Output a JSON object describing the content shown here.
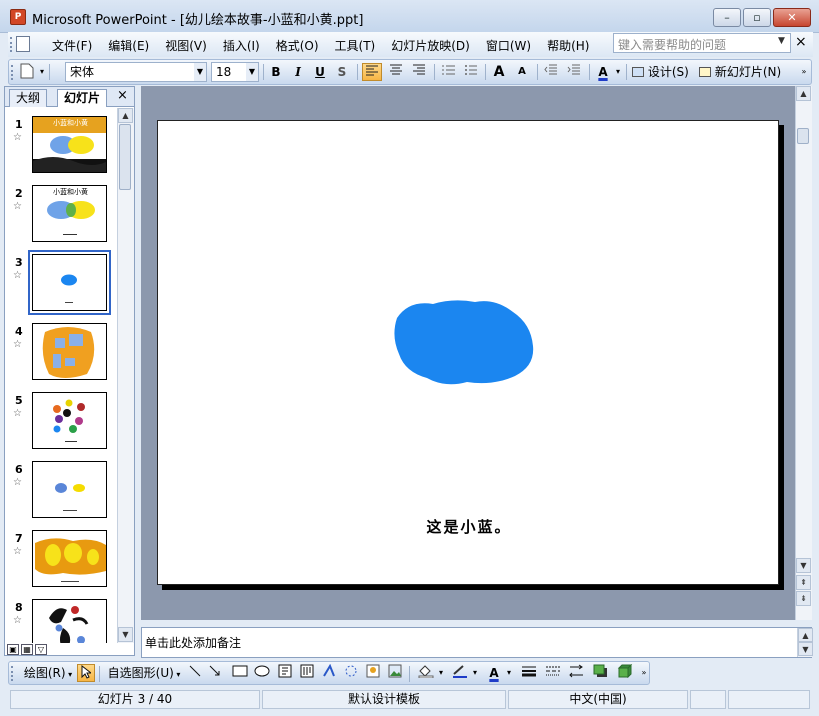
{
  "window": {
    "app_icon": "powerpoint-icon",
    "title": "Microsoft PowerPoint - [幼儿绘本故事-小蓝和小黄.ppt]",
    "buttons": {
      "minimize": "–",
      "restore": "▫",
      "close": "✕"
    }
  },
  "menubar": {
    "items": [
      {
        "label": "文件(F)"
      },
      {
        "label": "编辑(E)"
      },
      {
        "label": "视图(V)"
      },
      {
        "label": "插入(I)"
      },
      {
        "label": "格式(O)"
      },
      {
        "label": "工具(T)"
      },
      {
        "label": "幻灯片放映(D)"
      },
      {
        "label": "窗口(W)"
      },
      {
        "label": "帮助(H)"
      }
    ],
    "help_placeholder": "键入需要帮助的问题",
    "help_close": "×"
  },
  "toolbar": {
    "font_name": "宋体",
    "font_size": "18",
    "bold": "B",
    "italic": "I",
    "underline": "U",
    "shadow": "S",
    "grow_font": "A",
    "shrink_font": "A",
    "font_color": "A",
    "design_label": "设计(S)",
    "new_slide_label": "新幻灯片(N)"
  },
  "slide_pane": {
    "tabs": [
      {
        "label": "大纲"
      },
      {
        "label": "幻灯片"
      }
    ],
    "close": "×",
    "thumbnails": [
      {
        "number": "1",
        "star": "☆",
        "title_text": "小蓝和小黄"
      },
      {
        "number": "2",
        "star": "☆",
        "title_text": "小蓝和小黄"
      },
      {
        "number": "3",
        "star": "☆",
        "selected": true
      },
      {
        "number": "4",
        "star": "☆"
      },
      {
        "number": "5",
        "star": "☆"
      },
      {
        "number": "6",
        "star": "☆"
      },
      {
        "number": "7",
        "star": "☆"
      },
      {
        "number": "8",
        "star": "☆"
      }
    ]
  },
  "slide": {
    "caption": "这是小蓝。",
    "blob_color": "#1b86f0"
  },
  "notes": {
    "placeholder": "单击此处添加备注"
  },
  "drawing_toolbar": {
    "draw_label": "绘图(R)",
    "autoshapes_label": "自选图形(U)"
  },
  "statusbar": {
    "slide_position": "幻灯片 3 / 40",
    "template": "默认设计模板",
    "language": "中文(中国)"
  },
  "colors": {
    "accent": "#3165c8",
    "slide_blue": "#1b86f0",
    "slide_yellow": "#f5e400",
    "slide_orange": "#f0a020"
  }
}
